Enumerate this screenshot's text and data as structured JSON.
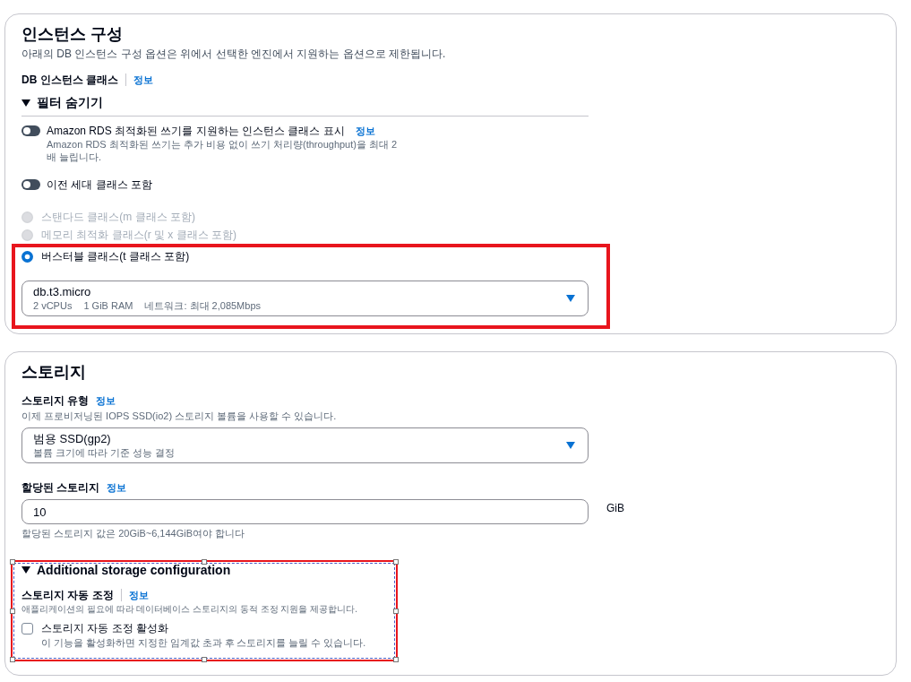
{
  "instance_config": {
    "title": "인스턴스 구성",
    "description": "아래의 DB 인스턴스 구성 옵션은 위에서 선택한 엔진에서 지원하는 옵션으로 제한됩니다.",
    "instance_class": {
      "label": "DB 인스턴스 클래스",
      "info_link": "정보",
      "info_separator": true
    },
    "filter": {
      "label": "필터 숨기기",
      "expanded": true,
      "toggles": [
        {
          "label": "Amazon RDS 최적화된 쓰기를 지원하는 인스턴스 클래스 표시",
          "info_link": "정보",
          "description": "Amazon RDS 최적화된 쓰기는 추가 비용 없이 쓰기 처리량(throughput)을 최대 2 배 늘립니다.",
          "on": false
        },
        {
          "label": "이전 세대 클래스 포함",
          "on": false
        }
      ]
    },
    "class_options": [
      {
        "label": "스탠다드 클래스(m 클래스 포함)",
        "selected": false,
        "disabled": true
      },
      {
        "label": "메모리 최적화 클래스(r 및 x 클래스 포함)",
        "selected": false,
        "disabled": true
      },
      {
        "label": "버스터블 클래스(t 클래스 포함)",
        "selected": true,
        "disabled": false
      }
    ],
    "instance_select": {
      "value": "db.t3.micro",
      "details": [
        "2 vCPUs",
        "1 GiB RAM",
        "네트워크: 최대 2,085Mbps"
      ]
    },
    "highlighted": true
  },
  "storage": {
    "title": "스토리지",
    "storage_type": {
      "label": "스토리지 유형",
      "info_link": "정보",
      "description": "이제 프로비저닝된 IOPS SSD(io2) 스토리지 볼륨을 사용할 수 있습니다.",
      "value": "범용 SSD(gp2)",
      "value_description": "볼륨 크기에 따라 기준 성능 결정"
    },
    "allocated_storage": {
      "label": "할당된 스토리지",
      "info_link": "정보",
      "value": "10",
      "unit": "GiB",
      "hint": "할당된 스토리지 값은 20GiB~6,144GiB여야 합니다"
    },
    "additional_config": {
      "title": "Additional storage configuration",
      "expanded": true,
      "editor_selected": true,
      "autoscaling": {
        "label": "스토리지 자동 조정",
        "info_link": "정보",
        "info_separator": true,
        "description": "애플리케이션의 필요에 따라 데이터베이스 스토리지의 동적 조정 지원을 제공합니다.",
        "checkbox_label": "스토리지 자동 조정 활성화",
        "checkbox_description": "이 기능을 활성화하면 지정한 임계값 초과 후 스토리지를 늘릴 수 있습니다.",
        "checked": false
      }
    }
  }
}
